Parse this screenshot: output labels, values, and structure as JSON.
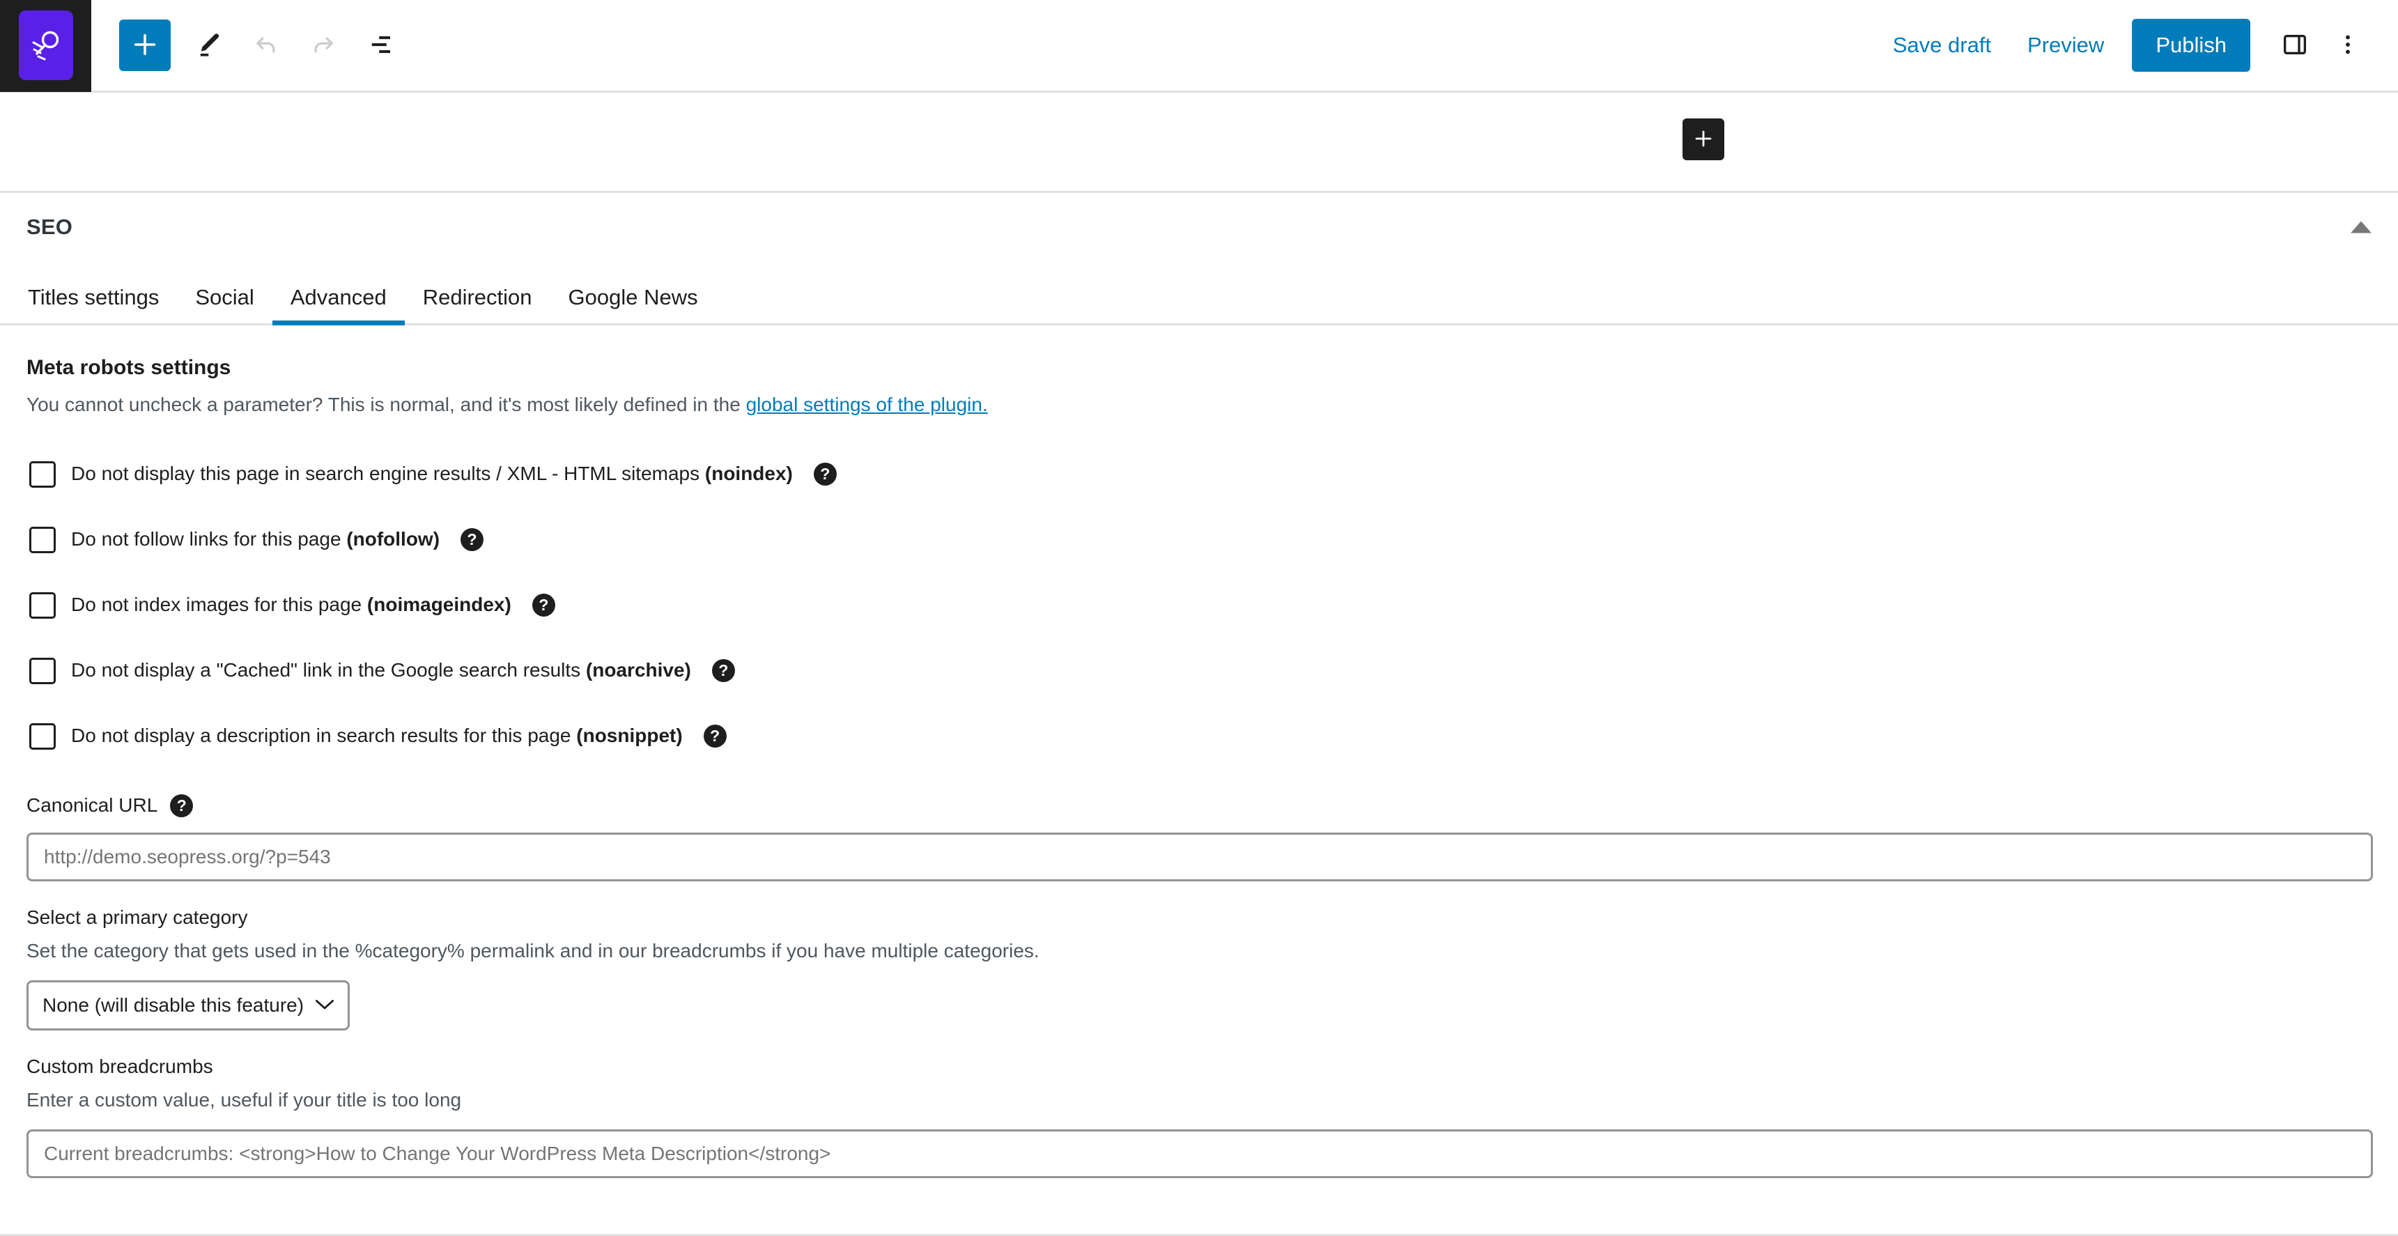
{
  "toolbar": {
    "logo_icon": "seopress-rocket-logo-icon",
    "add_block_label": "+",
    "buttons": [
      {
        "name": "add-block-button",
        "icon": "plus-icon"
      },
      {
        "name": "edit-tool-button",
        "icon": "pencil-icon"
      },
      {
        "name": "undo-button",
        "icon": "undo-arrow-icon"
      },
      {
        "name": "redo-button",
        "icon": "redo-arrow-icon"
      },
      {
        "name": "document-overview-button",
        "icon": "list-view-icon"
      }
    ],
    "save_draft_label": "Save draft",
    "preview_label": "Preview",
    "publish_label": "Publish",
    "settings_sidebar_icon": "sidebar-panel-icon",
    "more_options_icon": "three-dots-vertical-icon"
  },
  "canvas": {
    "inserter_icon": "plus-icon",
    "inserter_label": "+"
  },
  "seo_panel": {
    "title": "SEO",
    "collapse_icon": "caret-up-icon",
    "tabs": [
      {
        "label": "Titles settings",
        "active": false
      },
      {
        "label": "Social",
        "active": false
      },
      {
        "label": "Advanced",
        "active": true
      },
      {
        "label": "Redirection",
        "active": false
      },
      {
        "label": "Google News",
        "active": false
      }
    ],
    "accent_color": "#007cba"
  },
  "meta_robots": {
    "heading": "Meta robots settings",
    "description_prefix": "You cannot uncheck a parameter? This is normal, and it's most likely defined in the ",
    "description_link": "global settings of the plugin.",
    "help_glyph": "?",
    "checkboxes": [
      {
        "text": "Do not display this page in search engine results / XML - HTML sitemaps ",
        "token": "(noindex)",
        "checked": false,
        "name": "checkbox-noindex"
      },
      {
        "text": "Do not follow links for this page ",
        "token": "(nofollow)",
        "checked": false,
        "name": "checkbox-nofollow"
      },
      {
        "text": "Do not index images for this page ",
        "token": "(noimageindex)",
        "checked": false,
        "name": "checkbox-noimageindex"
      },
      {
        "text": "Do not display a \"Cached\" link in the Google search results ",
        "token": "(noarchive)",
        "checked": false,
        "name": "checkbox-noarchive"
      },
      {
        "text": "Do not display a description in search results for this page ",
        "token": "(nosnippet)",
        "checked": false,
        "name": "checkbox-nosnippet"
      }
    ]
  },
  "canonical": {
    "label": "Canonical URL",
    "help_glyph": "?",
    "value": "",
    "placeholder": "http://demo.seopress.org/?p=543"
  },
  "primary_category": {
    "label": "Select a primary category",
    "help": "Set the category that gets used in the %category% permalink and in our breadcrumbs if you have multiple categories.",
    "selected": "None (will disable this feature)",
    "options": [
      "None (will disable this feature)"
    ],
    "chevron_icon": "chevron-down-icon"
  },
  "custom_breadcrumbs": {
    "label": "Custom breadcrumbs",
    "help": "Enter a custom value, useful if your title is too long",
    "value": "",
    "placeholder": "Current breadcrumbs: <strong>How to Change Your WordPress Meta Description</strong>"
  }
}
